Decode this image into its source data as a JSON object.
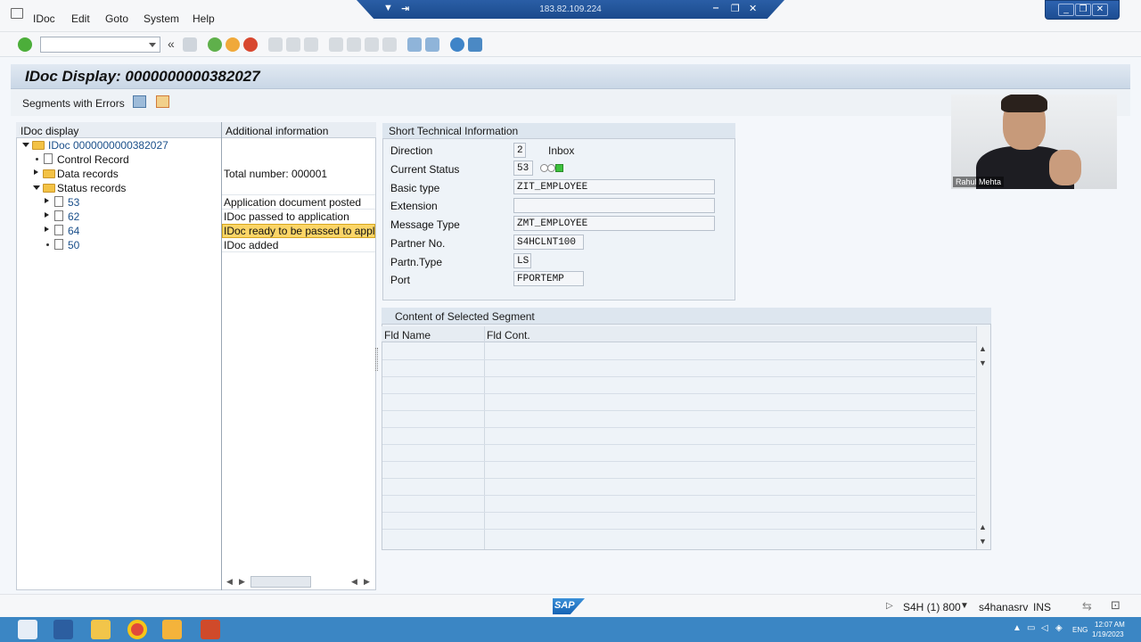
{
  "menu": {
    "items": [
      "IDoc",
      "Edit",
      "Goto",
      "System",
      "Help"
    ]
  },
  "remote": {
    "ip": "183.82.109.224"
  },
  "title": "IDoc Display: 0000000000382027",
  "app_toolbar": {
    "segments_with_errors": "Segments with Errors"
  },
  "tree": {
    "col_idoc": "IDoc display",
    "col_info": "Additional information",
    "root": "IDoc 0000000000382027",
    "control_record": "Control Record",
    "data_records": "Data records",
    "data_records_info": "Total number: 000001",
    "status_records": "Status records",
    "statuses": [
      {
        "code": "53",
        "text": "Application document posted"
      },
      {
        "code": "62",
        "text": "IDoc passed to application"
      },
      {
        "code": "64",
        "text": "IDoc ready to be passed to applica"
      },
      {
        "code": "50",
        "text": "IDoc added"
      }
    ]
  },
  "short_info": {
    "title": "Short Technical Information",
    "direction_label": "Direction",
    "direction": "2",
    "direction_text": "Inbox",
    "status_label": "Current Status",
    "status": "53",
    "basic_type_label": "Basic type",
    "basic_type": "ZIT_EMPLOYEE",
    "extension_label": "Extension",
    "extension": "",
    "message_type_label": "Message Type",
    "message_type": "ZMT_EMPLOYEE",
    "partner_no_label": "Partner No.",
    "partner_no": "S4HCLNT100",
    "partn_type_label": "Partn.Type",
    "partn_type": "LS",
    "port_label": "Port",
    "port": "FPORTEMP"
  },
  "segment": {
    "title": "Content of Selected Segment",
    "col_name": "Fld Name",
    "col_cont": "Fld Cont."
  },
  "webcam": {
    "name": "Rahul Mehta"
  },
  "status_bar": {
    "logo": "SAP",
    "system": "S4H (1) 800",
    "server": "s4hanasrv",
    "mode": "INS"
  },
  "taskbar": {
    "lang": "ENG",
    "time": "12:07 AM",
    "date": "1/19/2023"
  },
  "colors": {
    "accent": "#1a4f8a",
    "highlight": "#fbd567",
    "status_green": "#3cc13c"
  }
}
